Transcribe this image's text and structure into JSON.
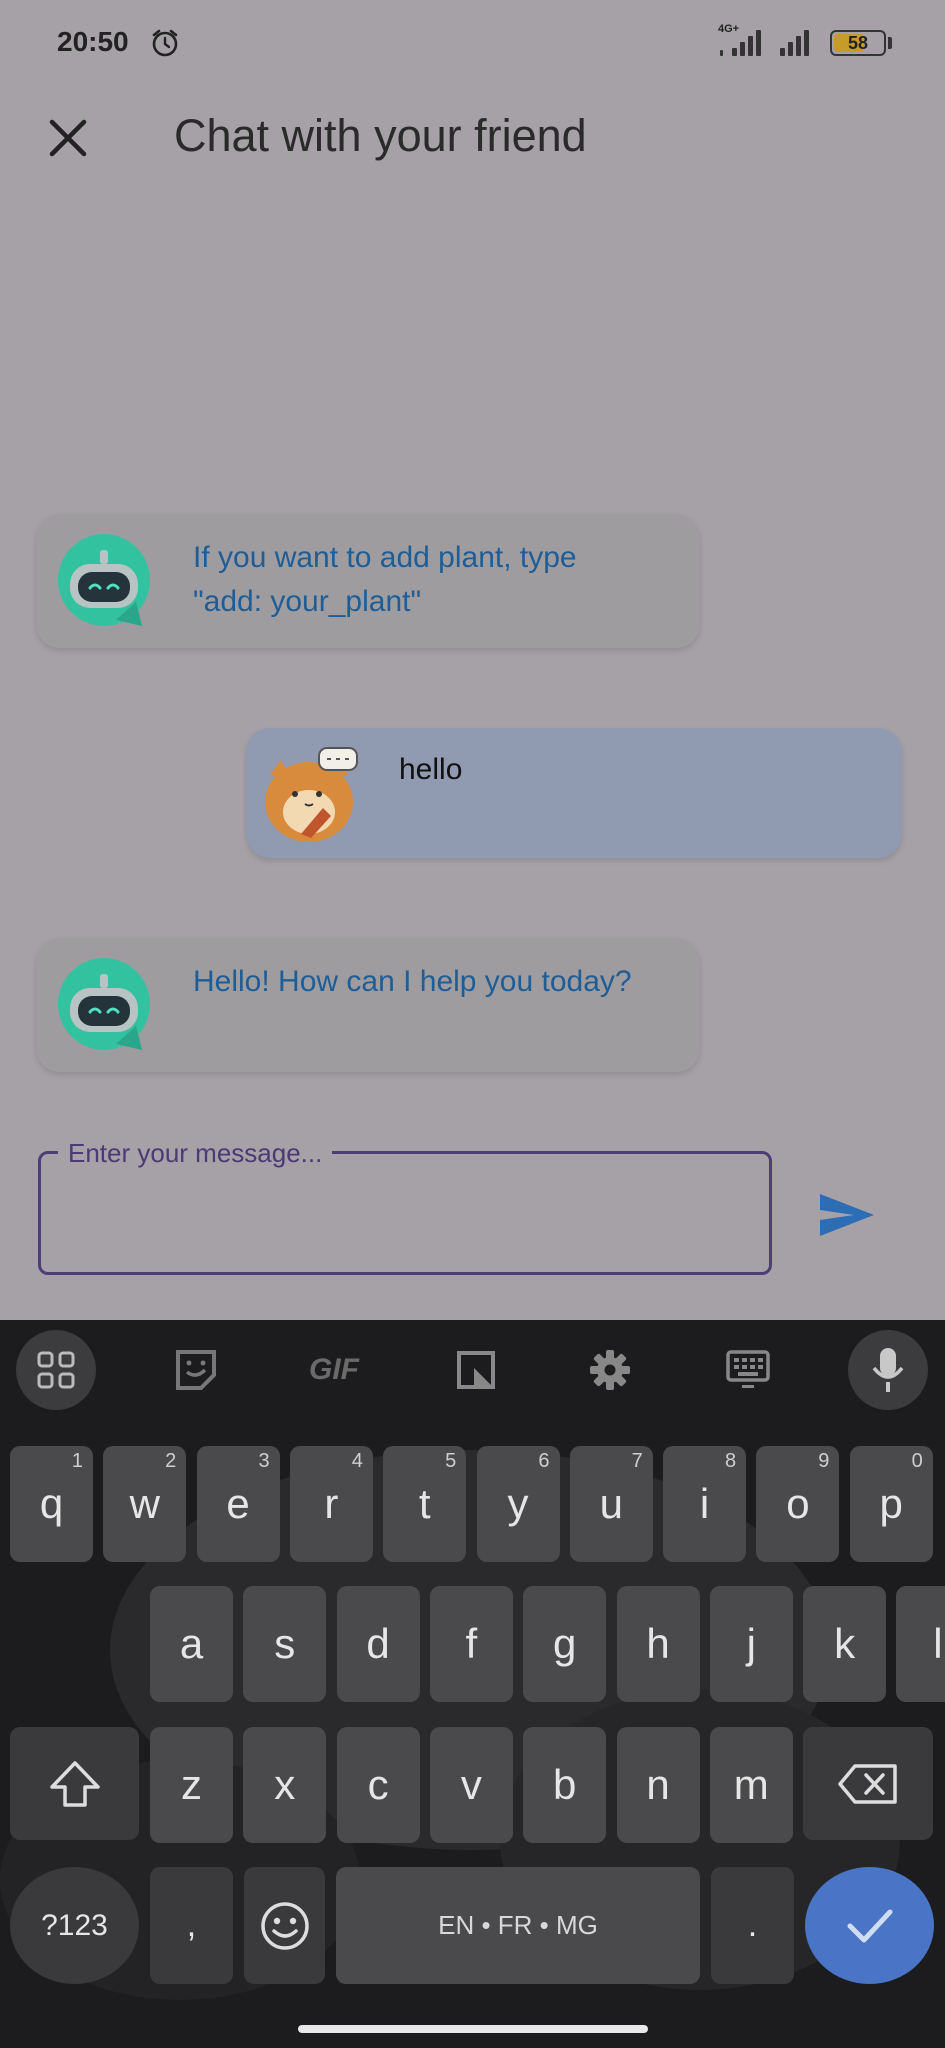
{
  "status_bar": {
    "time": "20:50",
    "network": "4G+",
    "battery": "58"
  },
  "header": {
    "title": "Chat with your friend"
  },
  "messages": [
    {
      "sender": "bot",
      "text_lines": [
        "If you want to add plant, type",
        "\"add: your_plant\""
      ]
    },
    {
      "sender": "user",
      "text_lines": [
        "hello"
      ]
    },
    {
      "sender": "bot",
      "text_lines": [
        "Hello! How can I help you today?"
      ]
    }
  ],
  "input": {
    "label": "Enter your message...",
    "value": ""
  },
  "keyboard": {
    "toolbar": [
      "apps-icon",
      "sticker-icon",
      "GIF",
      "clipboard-icon",
      "settings-gear-icon",
      "keyboard-icon",
      "mic-icon"
    ],
    "gif_label": "GIF",
    "row1": [
      {
        "k": "q",
        "n": "1"
      },
      {
        "k": "w",
        "n": "2"
      },
      {
        "k": "e",
        "n": "3"
      },
      {
        "k": "r",
        "n": "4"
      },
      {
        "k": "t",
        "n": "5"
      },
      {
        "k": "y",
        "n": "6"
      },
      {
        "k": "u",
        "n": "7"
      },
      {
        "k": "i",
        "n": "8"
      },
      {
        "k": "o",
        "n": "9"
      },
      {
        "k": "p",
        "n": "0"
      }
    ],
    "row2": [
      "a",
      "s",
      "d",
      "f",
      "g",
      "h",
      "j",
      "k",
      "l"
    ],
    "row3": [
      "z",
      "x",
      "c",
      "v",
      "b",
      "n",
      "m"
    ],
    "symbols_label": "?123",
    "comma_label": ",",
    "space_label": "EN • FR • MG",
    "period_label": "."
  },
  "colors": {
    "bot_text": "#1f5d96",
    "accent": "#4e3e78",
    "send": "#2d6db5",
    "enter": "#4a74c6"
  }
}
